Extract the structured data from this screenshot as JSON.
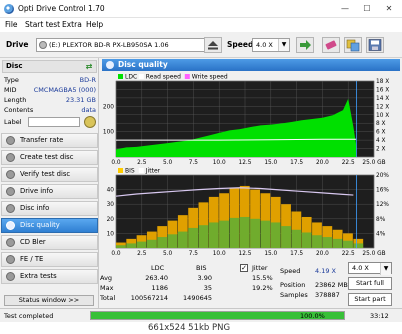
{
  "window": {
    "title": "Opti Drive Control 1.70",
    "minimize": "—",
    "maximize": "☐",
    "close": "✕"
  },
  "menu": [
    "File",
    "Start test",
    "Extra",
    "Help"
  ],
  "drivebar": {
    "drive_label": "Drive",
    "drive_value": "(E:)  PLEXTOR BD-R  PX-LB950SA 1.06",
    "speed_label": "Speed",
    "speed_value": "4.0 X"
  },
  "disc": {
    "header": "Disc",
    "rows": [
      {
        "key": "Type",
        "value": "BD-R"
      },
      {
        "key": "MID",
        "value": "CMCMAGBA5 (000)"
      },
      {
        "key": "Length",
        "value": "23.31 GB"
      },
      {
        "key": "Contents",
        "value": "data"
      },
      {
        "key": "Label",
        "value": ""
      }
    ]
  },
  "nav": [
    {
      "label": "Transfer rate",
      "active": false
    },
    {
      "label": "Create test disc",
      "active": false
    },
    {
      "label": "Verify test disc",
      "active": false
    },
    {
      "label": "Drive info",
      "active": false
    },
    {
      "label": "Disc info",
      "active": false
    },
    {
      "label": "Disc quality",
      "active": true
    },
    {
      "label": "CD Bler",
      "active": false
    },
    {
      "label": "FE / TE",
      "active": false
    },
    {
      "label": "Extra tests",
      "active": false
    }
  ],
  "status_window_button": "Status window >>",
  "panel_title": "Disc quality",
  "chart_data": [
    {
      "type": "area",
      "legend": [
        "LDC",
        "Read speed",
        "Write speed"
      ],
      "colors": {
        "LDC": "#00e000",
        "Read speed": "#ffffff",
        "Write speed": "#ff60ff"
      },
      "x_ticks": [
        "0.0",
        "2.5",
        "5.0",
        "7.5",
        "10.0",
        "12.5",
        "15.0",
        "17.5",
        "20.0",
        "22.5",
        "25.0 GB"
      ],
      "y_left_ticks": [
        "200",
        "100"
      ],
      "y_right_ticks": [
        "18 X",
        "16 X",
        "14 X",
        "12 X",
        "10 X",
        "8 X",
        "6 X",
        "4 X",
        "2 X"
      ],
      "xlim": [
        0,
        25
      ],
      "ylim": [
        0,
        300
      ],
      "series": [
        {
          "name": "LDC",
          "x": [
            0,
            1,
            2,
            3,
            4,
            5,
            6,
            7,
            8,
            9,
            10,
            11,
            12,
            13,
            14,
            15,
            16,
            17,
            18,
            19,
            20,
            21,
            22,
            22.5,
            23,
            23.3
          ],
          "values": [
            30,
            38,
            40,
            45,
            50,
            55,
            60,
            65,
            75,
            85,
            95,
            105,
            110,
            118,
            125,
            128,
            132,
            138,
            145,
            150,
            155,
            165,
            185,
            230,
            120,
            40
          ]
        },
        {
          "name": "Read speed",
          "x": [
            0,
            5,
            10,
            15,
            20,
            23.3
          ],
          "values": [
            4.0,
            4.0,
            4.0,
            4.1,
            4.2,
            4.2
          ]
        }
      ]
    },
    {
      "type": "bar",
      "legend": [
        "BIS",
        "Jitter"
      ],
      "colors": {
        "BIS": "#ffcc00",
        "Jitter": "#ffffff"
      },
      "x_ticks": [
        "0.0",
        "2.5",
        "5.0",
        "7.5",
        "10.0",
        "12.5",
        "15.0",
        "17.5",
        "20.0",
        "22.5",
        "25.0 GB"
      ],
      "y_left_ticks": [
        "40",
        "30",
        "20",
        "10"
      ],
      "y_right_ticks": [
        "20%",
        "16%",
        "12%",
        "8%",
        "4%"
      ],
      "xlim": [
        0,
        25
      ],
      "ylim": [
        0,
        40
      ],
      "series": [
        {
          "name": "BIS",
          "x": [
            0,
            1,
            2,
            3,
            4,
            5,
            6,
            7,
            8,
            9,
            10,
            11,
            12,
            13,
            14,
            15,
            16,
            17,
            18,
            19,
            20,
            21,
            22,
            23
          ],
          "values": [
            3,
            5,
            7,
            9,
            12,
            15,
            18,
            22,
            25,
            28,
            30,
            33,
            34,
            32,
            30,
            28,
            24,
            20,
            17,
            14,
            12,
            10,
            8,
            5
          ]
        },
        {
          "name": "Jitter",
          "x": [
            0,
            2,
            4,
            6,
            8,
            10,
            12,
            14,
            16,
            18,
            20,
            22,
            23
          ],
          "values": [
            14.2,
            14.8,
            15.2,
            15.6,
            16.0,
            16.3,
            16.5,
            16.3,
            15.9,
            15.5,
            15.1,
            14.7,
            14.5
          ]
        }
      ]
    }
  ],
  "stats": {
    "headers": {
      "ldc": "LDC",
      "bis": "BIS"
    },
    "jitter_label": "Jitter",
    "jitter_checked": "✓",
    "rows": [
      {
        "label": "Avg",
        "ldc": "263.40",
        "bis": "3.90",
        "jitter": "15.5%"
      },
      {
        "label": "Max",
        "ldc": "1186",
        "bis": "35",
        "jitter": "19.2%"
      },
      {
        "label": "Total",
        "ldc": "100567214",
        "bis": "1490645",
        "jitter": ""
      }
    ],
    "speed_label": "Speed",
    "speed_value": "4.19 X",
    "position_label": "Position",
    "position_value": "23862 MB",
    "samples_label": "Samples",
    "samples_value": "378887",
    "speed_select": "4.0 X",
    "start_full": "Start full",
    "start_part": "Start part"
  },
  "statusbar": {
    "left": "Test completed",
    "progress_text": "100.0%",
    "progress": 1.0,
    "time": "33:12"
  },
  "viewer_caption": "661x524 51kb PNG"
}
